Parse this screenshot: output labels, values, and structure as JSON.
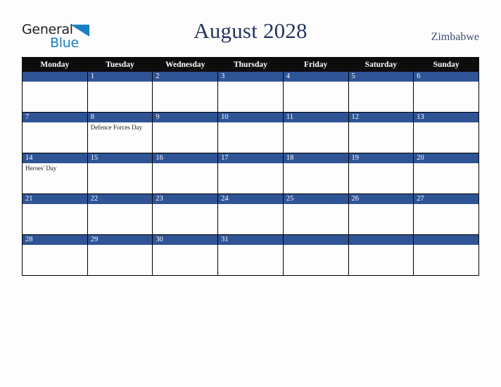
{
  "brand": {
    "name_top": "General",
    "name_bottom": "Blue",
    "triangle_icon": "triangle-icon",
    "color_dark": "#231f20",
    "color_blue": "#1a7ec4"
  },
  "header": {
    "title": "August 2028",
    "country": "Zimbabwe",
    "title_color": "#24355f"
  },
  "calendar": {
    "weekday_headers": [
      "Monday",
      "Tuesday",
      "Wednesday",
      "Thursday",
      "Friday",
      "Saturday",
      "Sunday"
    ],
    "header_bg": "#0d0d0d",
    "daybar_bg": "#2f5496",
    "cell_bg": "#fdfdfd",
    "border_color": "#000000",
    "weeks": [
      [
        {
          "day": "",
          "events": []
        },
        {
          "day": "1",
          "events": []
        },
        {
          "day": "2",
          "events": []
        },
        {
          "day": "3",
          "events": []
        },
        {
          "day": "4",
          "events": []
        },
        {
          "day": "5",
          "events": []
        },
        {
          "day": "6",
          "events": []
        }
      ],
      [
        {
          "day": "7",
          "events": []
        },
        {
          "day": "8",
          "events": [
            "Defence Forces Day"
          ]
        },
        {
          "day": "9",
          "events": []
        },
        {
          "day": "10",
          "events": []
        },
        {
          "day": "11",
          "events": []
        },
        {
          "day": "12",
          "events": []
        },
        {
          "day": "13",
          "events": []
        }
      ],
      [
        {
          "day": "14",
          "events": [
            "Heroes' Day"
          ]
        },
        {
          "day": "15",
          "events": []
        },
        {
          "day": "16",
          "events": []
        },
        {
          "day": "17",
          "events": []
        },
        {
          "day": "18",
          "events": []
        },
        {
          "day": "19",
          "events": []
        },
        {
          "day": "20",
          "events": []
        }
      ],
      [
        {
          "day": "21",
          "events": []
        },
        {
          "day": "22",
          "events": []
        },
        {
          "day": "23",
          "events": []
        },
        {
          "day": "24",
          "events": []
        },
        {
          "day": "25",
          "events": []
        },
        {
          "day": "26",
          "events": []
        },
        {
          "day": "27",
          "events": []
        }
      ],
      [
        {
          "day": "28",
          "events": []
        },
        {
          "day": "29",
          "events": []
        },
        {
          "day": "30",
          "events": []
        },
        {
          "day": "31",
          "events": []
        },
        {
          "day": "",
          "events": []
        },
        {
          "day": "",
          "events": []
        },
        {
          "day": "",
          "events": []
        }
      ]
    ]
  }
}
